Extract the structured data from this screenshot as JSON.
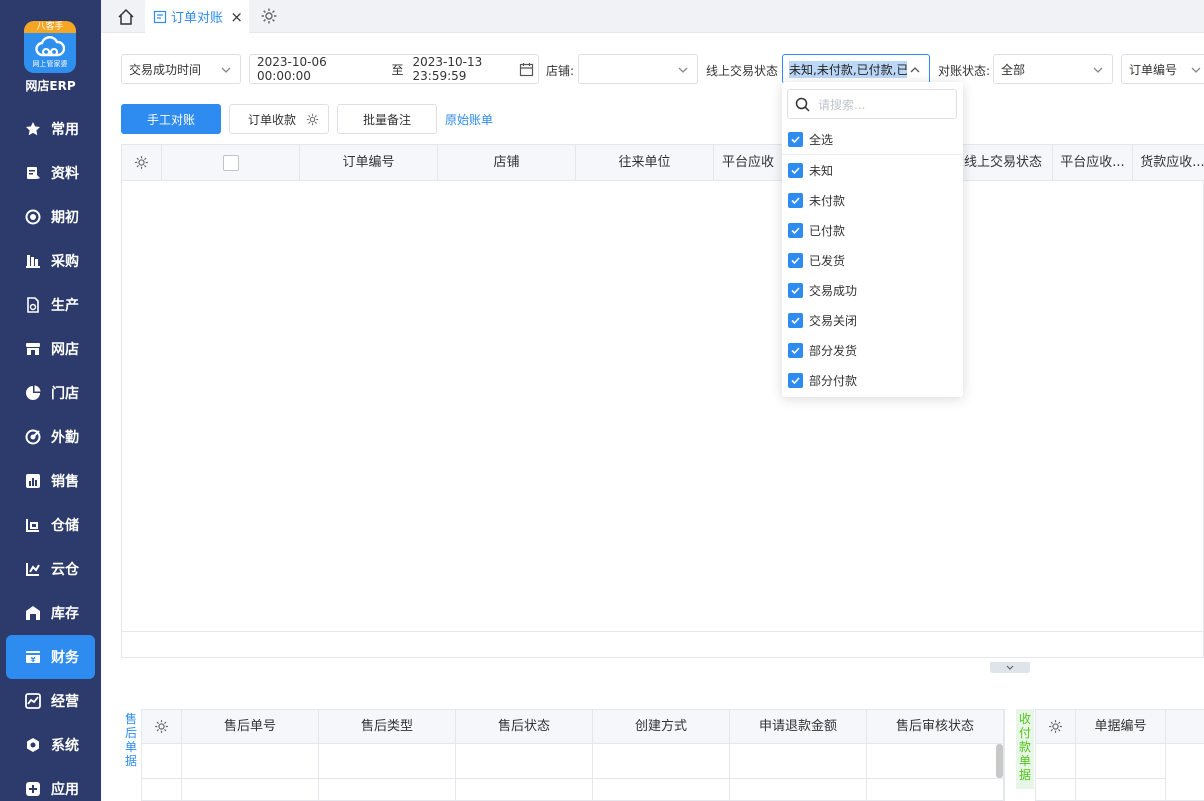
{
  "app": {
    "logo_band": "八客手",
    "logo_sub": "网上管家婆",
    "name": "网店ERP"
  },
  "sidebar": {
    "items": [
      {
        "label": "常用",
        "icon": "star-icon"
      },
      {
        "label": "资料",
        "icon": "document-icon"
      },
      {
        "label": "期初",
        "icon": "target-icon"
      },
      {
        "label": "采购",
        "icon": "cart-icon"
      },
      {
        "label": "生产",
        "icon": "factory-icon"
      },
      {
        "label": "网店",
        "icon": "store-icon"
      },
      {
        "label": "门店",
        "icon": "pie-icon"
      },
      {
        "label": "外勤",
        "icon": "location-icon"
      },
      {
        "label": "销售",
        "icon": "bar-chart-icon"
      },
      {
        "label": "仓储",
        "icon": "warehouse-icon"
      },
      {
        "label": "云仓",
        "icon": "cloud-warehouse-icon"
      },
      {
        "label": "库存",
        "icon": "inventory-icon"
      },
      {
        "label": "财务",
        "icon": "finance-icon",
        "active": true
      },
      {
        "label": "经营",
        "icon": "trend-icon"
      },
      {
        "label": "系统",
        "icon": "hexagon-gear-icon"
      },
      {
        "label": "应用",
        "icon": "plus-app-icon"
      }
    ]
  },
  "tabs": {
    "active_label": "订单对账",
    "close": "×"
  },
  "filters": {
    "time_type": "交易成功时间",
    "date_start": "2023-10-06 00:00:00",
    "date_to": "至",
    "date_end": "2023-10-13 23:59:59",
    "shop_label": "店铺:",
    "shop_value": "",
    "online_status_label": "线上交易状态",
    "online_status_value": "未知,未付款,已付款,已",
    "recon_status_label": "对账状态:",
    "recon_status_value": "全部",
    "order_no_field": "订单编号"
  },
  "toolbar": {
    "manual_recon": "手工对账",
    "order_receipt": "订单收款",
    "batch_note": "批量备注",
    "original_bill": "原始账单"
  },
  "main_table": {
    "columns": [
      "订单编号",
      "店铺",
      "往来单位",
      "平台应收",
      "线上交易状态",
      "平台应收...",
      "货款应收..."
    ]
  },
  "dropdown": {
    "search_placeholder": "请搜索...",
    "select_all": "全选",
    "options": [
      "未知",
      "未付款",
      "已付款",
      "已发货",
      "交易成功",
      "交易关闭",
      "部分发货",
      "部分付款"
    ]
  },
  "after_sales": {
    "side_label": "售后单据",
    "columns": [
      "售后单号",
      "售后类型",
      "售后状态",
      "创建方式",
      "申请退款金额",
      "售后审核状态"
    ]
  },
  "receipts": {
    "side_label": "收付款单据",
    "columns": [
      "单据编号"
    ]
  },
  "colors": {
    "sidebar_bg": "#2c3b6b",
    "accent": "#2e8cf0",
    "border": "#e4e7ed",
    "header_bg": "#f5f7fa"
  }
}
